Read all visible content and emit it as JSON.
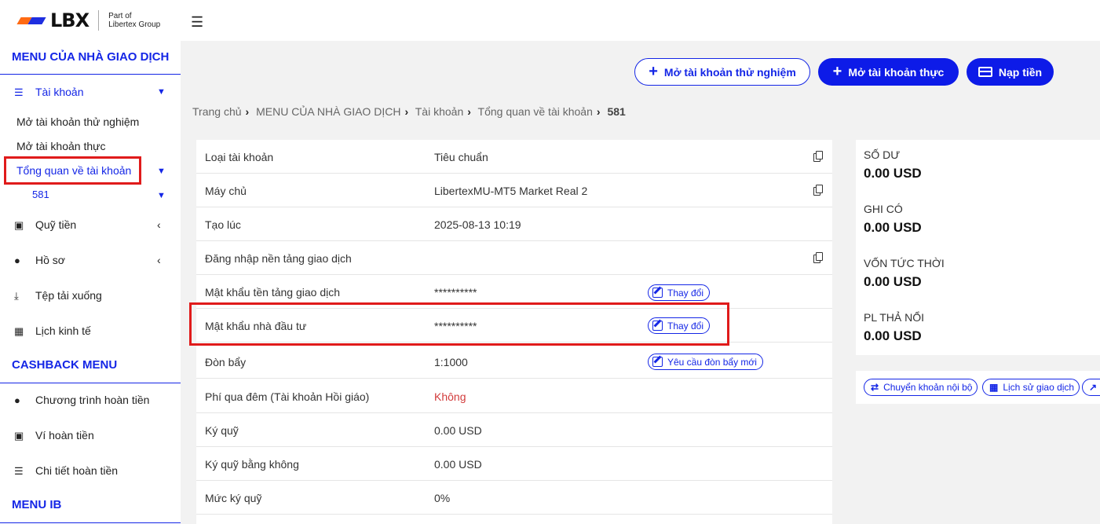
{
  "brand": {
    "logo_text": "LBX",
    "sub_line1": "Part of",
    "sub_line2": "Libertex Group",
    "accent": "#1426e6",
    "highlight": "#e01b1b"
  },
  "sidebar": {
    "trader_menu_title": "MENU CỦA NHÀ GIAO DỊCH",
    "account": {
      "label": "Tài khoản",
      "icon": "list-icon"
    },
    "open_demo": "Mở tài khoản thử nghiệm",
    "open_real": "Mở tài khoản thực",
    "overview": "Tổng quan về tài khoản",
    "account_number": "581",
    "funds": {
      "label": "Quỹ tiền",
      "icon": "wallet-icon"
    },
    "profile": {
      "label": "Hồ sơ",
      "icon": "user-icon"
    },
    "downloads": {
      "label": "Tệp tải xuống",
      "icon": "download-icon"
    },
    "calendar": {
      "label": "Lịch kinh tế",
      "icon": "calendar-icon"
    },
    "cashback_title": "CASHBACK MENU",
    "cashback_program": "Chương trình hoàn tiền",
    "cashback_wallet": "Ví hoàn tiền",
    "cashback_details": "Chi tiết hoàn tiền",
    "ib_title": "MENU IB"
  },
  "header": {
    "demo_button": "Mở tài khoản thử nghiệm",
    "real_button": "Mở tài khoản thực",
    "deposit_button": "Nạp tiền"
  },
  "breadcrumb": [
    "Trang chủ",
    "MENU CỦA NHÀ GIAO DỊCH",
    "Tài khoản",
    "Tổng quan về tài khoản",
    "581"
  ],
  "details": [
    {
      "key": "Loại tài khoản",
      "value": "Tiêu chuẩn"
    },
    {
      "key": "Máy chủ",
      "value": "LibertexMU-MT5 Market Real 2"
    },
    {
      "key": "Tạo lúc",
      "value": "2025-08-13 10:19"
    },
    {
      "key": "Đăng nhập nền tảng giao dịch",
      "value": ""
    },
    {
      "key": "Mật khẩu tền tảng giao dịch",
      "value": "**********",
      "action": "Thay đổi"
    },
    {
      "key": "Mật khẩu nhà đầu tư",
      "value": "**********",
      "action": "Thay đổi"
    },
    {
      "key": "Đòn bẩy",
      "value": "1:1000",
      "action": "Yêu cầu đòn bẩy mới"
    },
    {
      "key": "Phí qua đêm (Tài khoản Hồi giáo)",
      "value": "Không"
    },
    {
      "key": "Ký quỹ",
      "value": "0.00 USD"
    },
    {
      "key": "Ký quỹ bằng không",
      "value": "0.00 USD"
    },
    {
      "key": "Mức ký quỹ",
      "value": "0%"
    }
  ],
  "balance": [
    {
      "label": "SỐ DƯ",
      "value": "0.00 USD"
    },
    {
      "label": "GHI CÓ",
      "value": "0.00 USD"
    },
    {
      "label": "VỐN TỨC THỜI",
      "value": "0.00 USD"
    },
    {
      "label": "PL THẢ NỔI",
      "value": "0.00 USD"
    }
  ],
  "actions": {
    "transfer": "Chuyển khoản nội bộ",
    "history": "Lịch sử giao dịch"
  }
}
